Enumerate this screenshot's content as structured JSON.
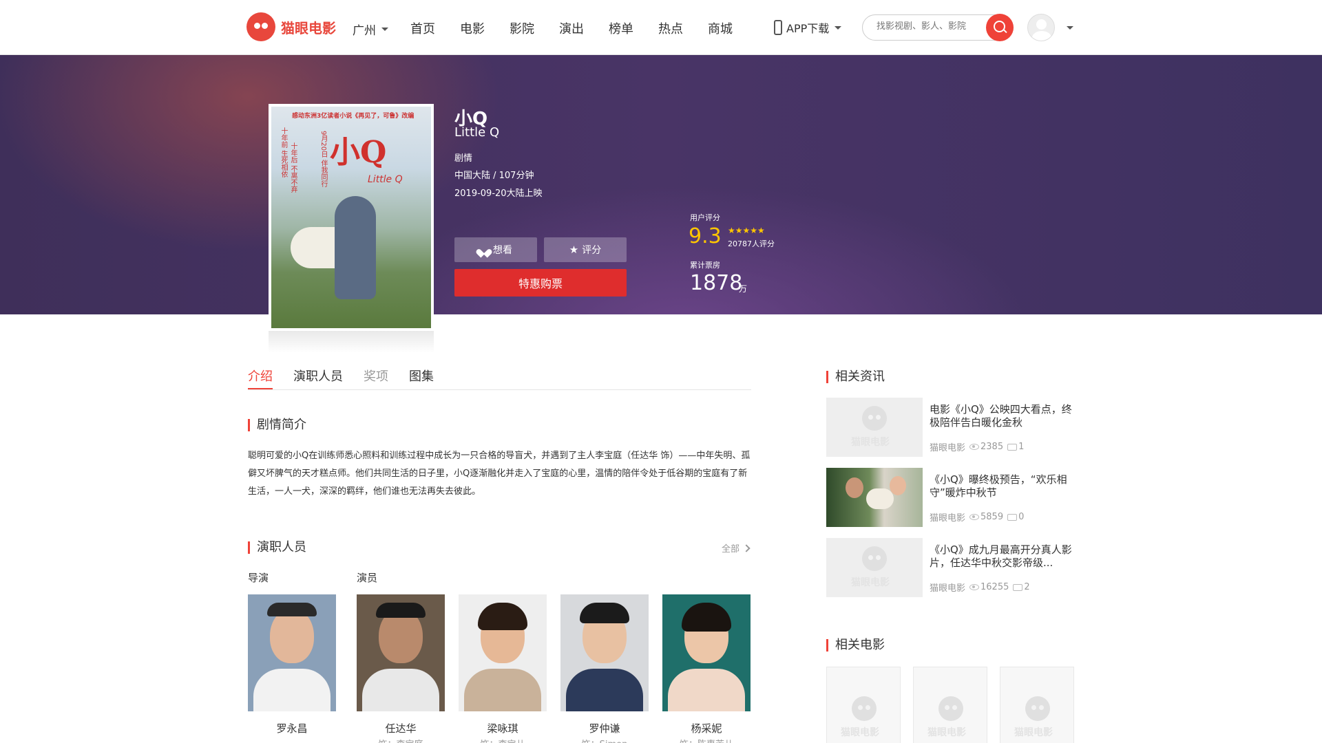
{
  "header": {
    "logo_text": "猫眼电影",
    "city": "广州",
    "nav": [
      "首页",
      "电影",
      "影院",
      "演出",
      "榜单",
      "热点",
      "商城"
    ],
    "app_download": "APP下载",
    "search_placeholder": "找影视剧、影人、影院"
  },
  "movie": {
    "title": "小Q",
    "title_en": "Little Q",
    "genre": "剧情",
    "meta": "中国大陆 / 107分钟",
    "release": "2019-09-20大陆上映",
    "poster": {
      "tagline": "感动东洲3亿读者小说《再见了，可鲁》改编",
      "big_title": "小Q",
      "side_left": "十年前 生死相依",
      "side_mid": "9月20日 伴我同行",
      "side_right": "十年后 不离不弃",
      "en": "Little Q"
    },
    "want_label": "想看",
    "rate_label": "评分",
    "buy_label": "特惠购票",
    "score_label": "用户评分",
    "score": "9.3",
    "stars": "★★★★★",
    "score_count": "20787人评分",
    "box_label": "累计票房",
    "box_value": "1878",
    "box_unit": "万"
  },
  "tabs": [
    "介绍",
    "演职人员",
    "奖项",
    "图集"
  ],
  "synopsis": {
    "title": "剧情简介",
    "text": "聪明可爱的小Q在训练师悉心照料和训练过程中成长为一只合格的导盲犬，并遇到了主人李宝庭（任达华 饰）——中年失明、孤僻又坏脾气的天才糕点师。他们共同生活的日子里，小Q逐渐融化并走入了宝庭的心里，温情的陪伴令处于低谷期的宝庭有了新生活，一人一犬，深深的羁绊，他们谁也无法再失去彼此。"
  },
  "cast": {
    "title": "演职人员",
    "all_label": "全部",
    "director_label": "导演",
    "actor_label": "演员",
    "people": [
      {
        "name": "罗永昌",
        "role": ""
      },
      {
        "name": "任达华",
        "role": "饰：李宝庭"
      },
      {
        "name": "梁咏琪",
        "role": "饰：李宝儿"
      },
      {
        "name": "罗仲谦",
        "role": "饰：Simon"
      },
      {
        "name": "杨采妮",
        "role": "饰：陈惠芳儿"
      }
    ]
  },
  "sidebar": {
    "news_title": "相关资讯",
    "news": [
      {
        "title": "电影《小Q》公映四大看点，终极陪伴告白暖化金秋",
        "source": "猫眼电影",
        "views": "2385",
        "comments": "1"
      },
      {
        "title": "《小Q》曝终极预告，“欢乐相守”暖炸中秋节",
        "source": "猫眼电影",
        "views": "5859",
        "comments": "0"
      },
      {
        "title": "《小Q》成九月最高开分真人影片，任达华中秋交影帝级...",
        "source": "猫眼电影",
        "views": "16255",
        "comments": "2"
      }
    ],
    "placeholder_text": "猫眼电影",
    "related_title": "相关电影"
  }
}
